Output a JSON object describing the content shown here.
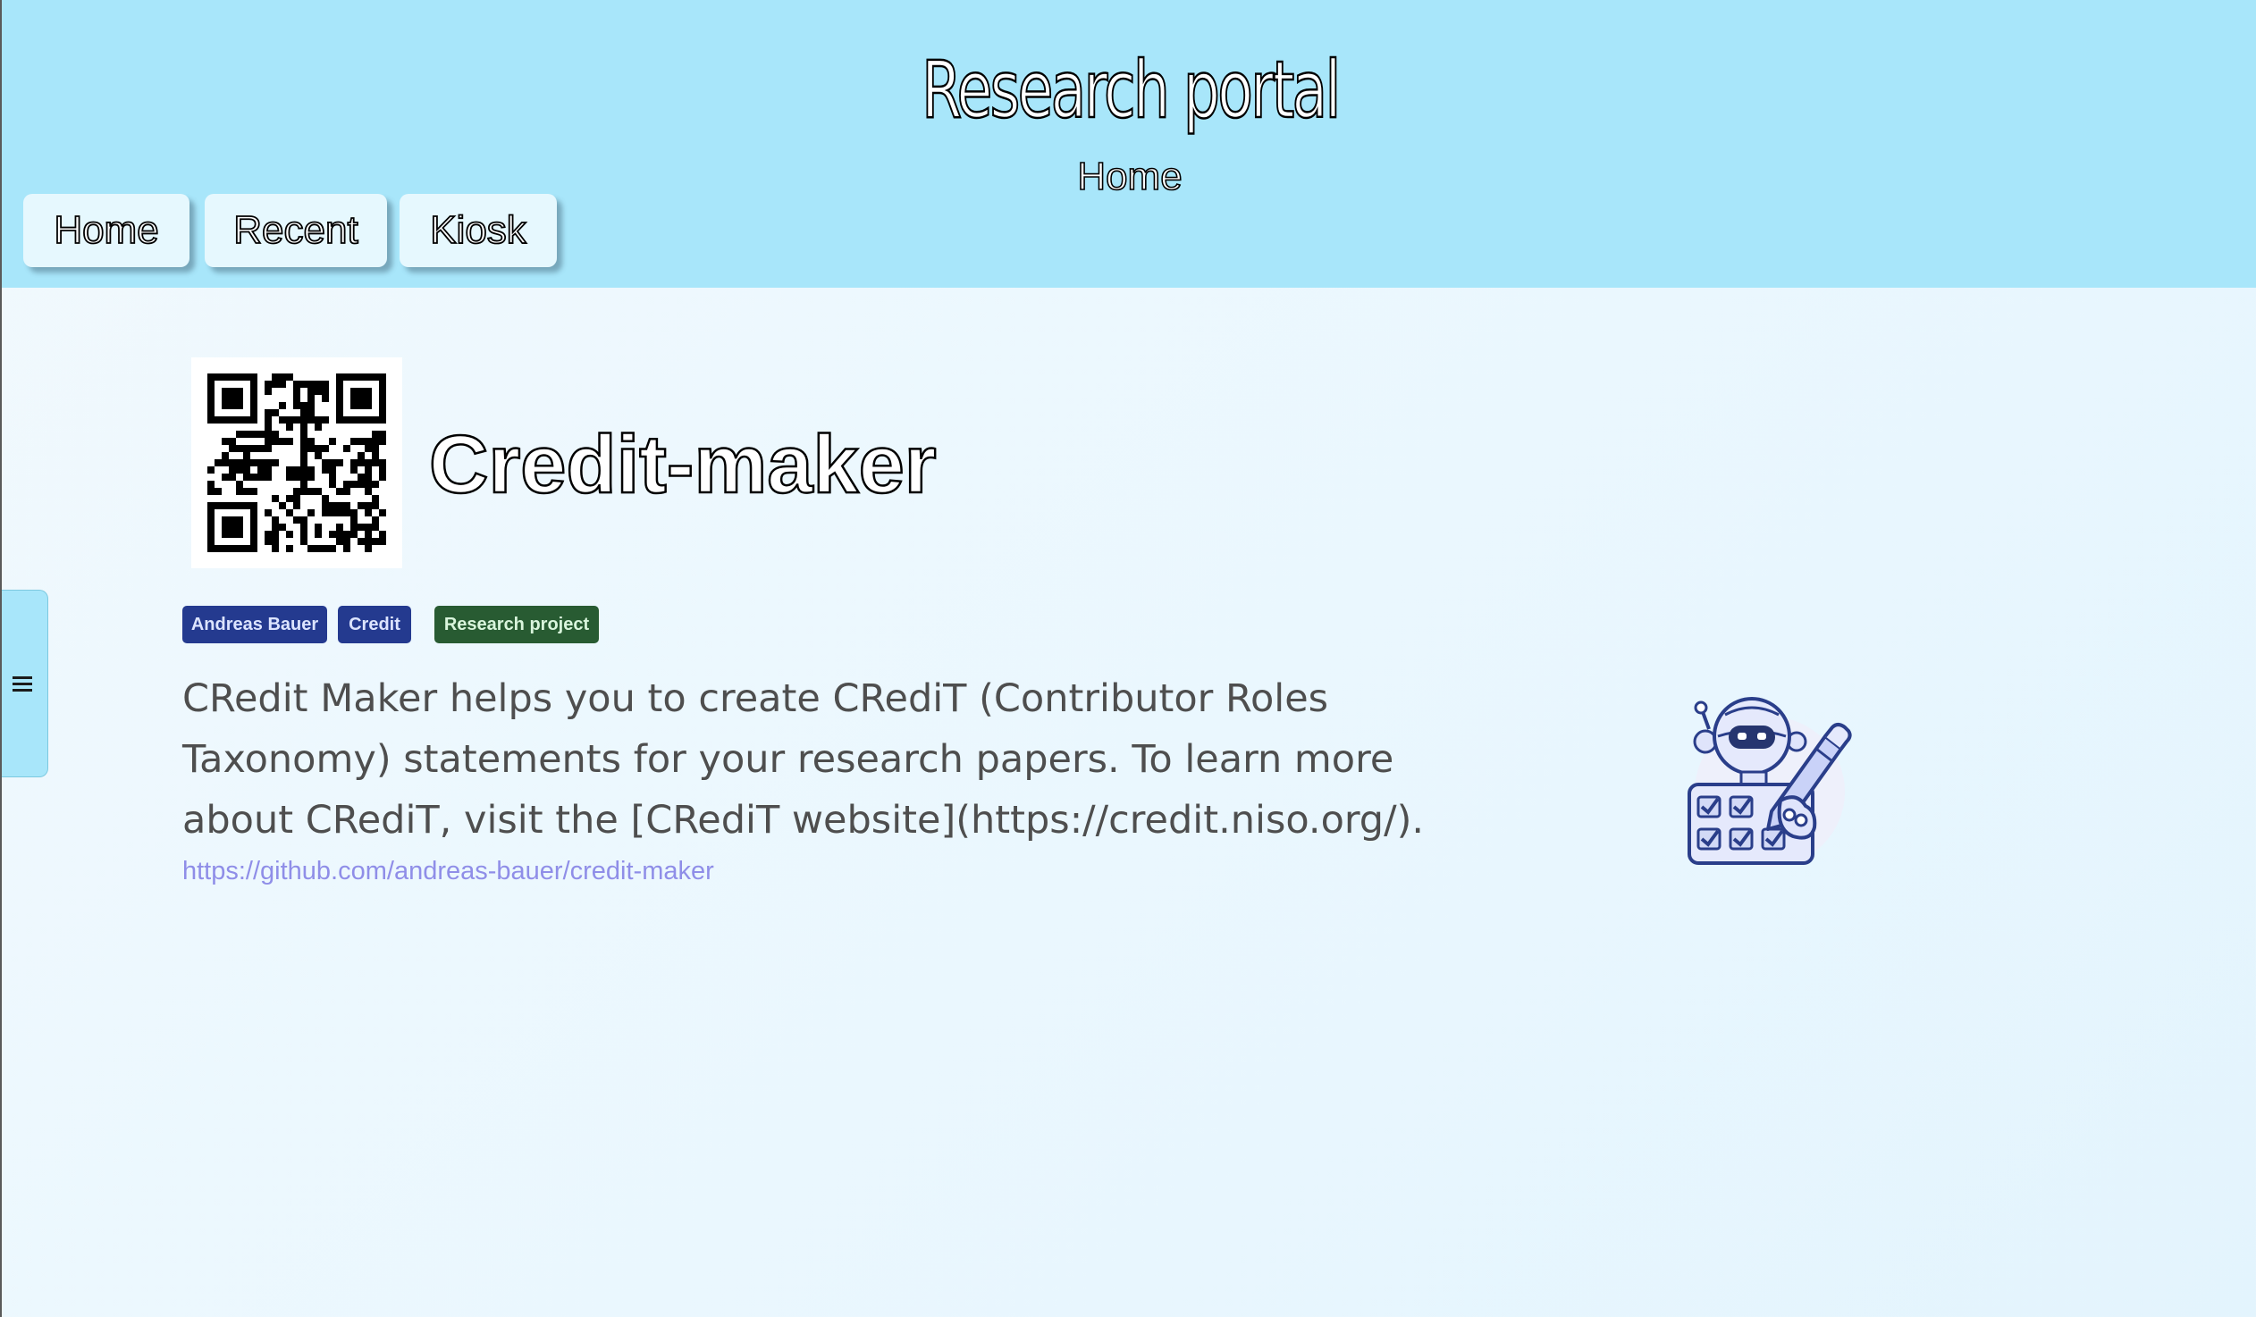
{
  "header": {
    "site_title": "Research portal",
    "page_subtitle": "Home",
    "background_color": "#a8e6fa"
  },
  "nav": {
    "tabs": [
      {
        "label": "Home"
      },
      {
        "label": "Recent"
      },
      {
        "label": "Kiosk"
      }
    ]
  },
  "sidebar": {
    "toggle_icon": "menu-icon"
  },
  "project": {
    "qr_icon": "qr-code-icon",
    "title": "Credit-maker",
    "tags": [
      {
        "label": "Andreas Bauer",
        "color": "#243a8f"
      },
      {
        "label": "Credit",
        "color": "#243a8f"
      },
      {
        "label": "Research project",
        "color": "#285b32"
      }
    ],
    "description": "CRedit Maker helps you to create CRediT (Contributor Roles Taxonomy) statements for your research papers. To learn more about CRediT, visit the [CRediT website](https://credit.niso.org/).",
    "link": "https://github.com/andreas-bauer/credit-maker",
    "illustration_icon": "robot-checklist-icon"
  }
}
